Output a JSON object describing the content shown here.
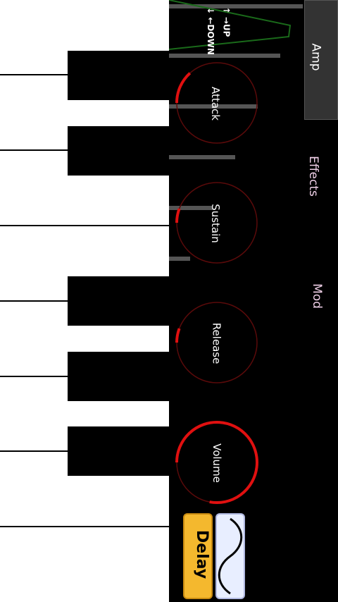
{
  "keyboard": {
    "white_keys": 8,
    "black_keys": [
      1,
      2,
      4,
      5,
      6
    ]
  },
  "envelope": {
    "up_hint": "↑ →UP",
    "down_hint": "↓ ←DOWN"
  },
  "knobs": [
    {
      "label": "Attack",
      "value_fraction": 0.14
    },
    {
      "label": "Sustain",
      "value_fraction": 0.06
    },
    {
      "label": "Release",
      "value_fraction": 0.06
    },
    {
      "label": "Volume",
      "value_fraction": 0.82
    }
  ],
  "tabs": [
    {
      "label": "Amp",
      "active": true
    },
    {
      "label": "Effects",
      "active": false
    },
    {
      "label": "Mod",
      "active": false
    }
  ],
  "buttons": {
    "delay": "Delay",
    "waveform_icon": "sine-wave-icon"
  },
  "colors": {
    "knob_arc": "#e01010",
    "knob_ring": "#5a0a0a",
    "envelope_line": "#1a6a1a",
    "tab_effects": "#f0d0e8",
    "delay_bg": "#f4b82e"
  }
}
